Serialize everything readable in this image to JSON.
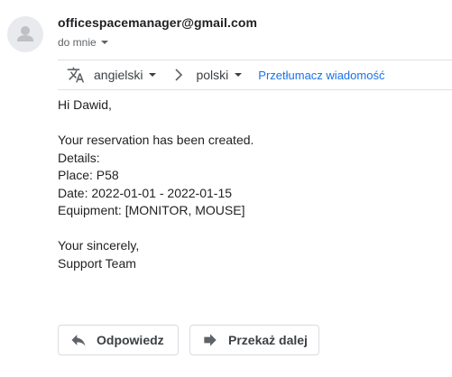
{
  "email": {
    "sender": "officespacemanager@gmail.com",
    "recipient": "do mnie",
    "avatar_icon": "person-avatar-icon"
  },
  "translate_bar": {
    "icon": "translate-icon",
    "from_lang": "angielski",
    "to_lang": "polski",
    "action_link": "Przetłumacz wiadomość"
  },
  "body_lines": [
    "Hi Dawid,",
    "",
    "Your reservation has been created.",
    "Details:",
    "Place: P58",
    "Date: 2022-01-01 - 2022-01-15",
    "Equipment: [MONITOR, MOUSE]",
    "",
    "Your sincerely,",
    "Support Team"
  ],
  "actions": {
    "reply_label": "Odpowiedz",
    "reply_icon": "reply-icon",
    "forward_label": "Przekaż dalej",
    "forward_icon": "forward-icon"
  }
}
